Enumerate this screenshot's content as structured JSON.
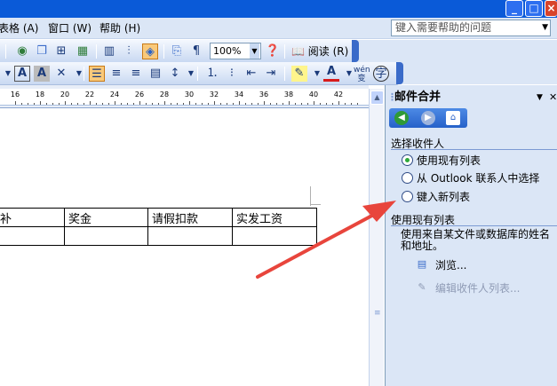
{
  "window": {
    "min_glyph": "_",
    "max_glyph": "□",
    "close_glyph": "×"
  },
  "menubar": {
    "items": [
      "表格 (A)",
      "窗口 (W)",
      "帮助 (H)"
    ],
    "help_placeholder": "键入需要帮助的问题"
  },
  "toolbar1": {
    "zoom": "100%",
    "read_label": "阅读 (R)",
    "icons": [
      "research-icon",
      "copy-icon",
      "insert-table-icon",
      "spreadsheet-icon",
      "columns-icon",
      "drawing-icon",
      "document-map-icon",
      "paragraph-marks-icon",
      "help-icon",
      "read-icon"
    ]
  },
  "toolbar2": {
    "bold_a": "A",
    "shaded_a": "A",
    "phonetic_label": "wén"
  },
  "ruler": {
    "ticks": [
      "16",
      "18",
      "20",
      "22",
      "24",
      "26",
      "28",
      "30",
      "32",
      "34",
      "36",
      "38",
      "40",
      "42"
    ]
  },
  "document": {
    "table_headers": [
      "补",
      "奖金",
      "请假扣款",
      "实发工资"
    ],
    "table_row": [
      "",
      "",
      "",
      ""
    ]
  },
  "taskpane": {
    "title": "邮件合并",
    "select_recipients_heading": "选择收件人",
    "options": [
      {
        "label": "使用现有列表",
        "selected": true
      },
      {
        "label": "从 Outlook 联系人中选择",
        "selected": false
      },
      {
        "label": "键入新列表",
        "selected": false
      }
    ],
    "use_existing_heading": "使用现有列表",
    "description": "使用来自某文件或数据库的姓名和地址。",
    "browse_label": "浏览...",
    "edit_label": "编辑收件人列表..."
  },
  "colors": {
    "titlebar": "#0a5ad8",
    "toolbar_bg": "#dbe6f6",
    "annotation_arrow": "#e8453c",
    "radio_selected": "#2ea93a"
  }
}
